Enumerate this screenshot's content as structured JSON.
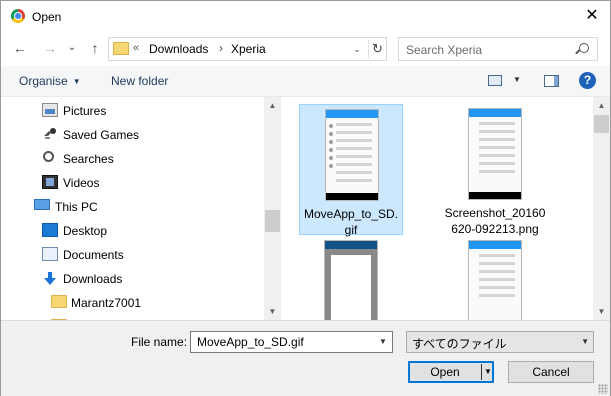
{
  "window": {
    "title": "Open",
    "close_label": "✕"
  },
  "navigation": {
    "back_icon": "←",
    "forward_icon": "→",
    "recent_icon": "⌄",
    "up_icon": "↑",
    "address": {
      "overflow": "«",
      "crumbs": [
        "Downloads",
        "Xperia"
      ],
      "separator": "›",
      "dropdown_icon": "⌄",
      "refresh_icon": "↻"
    },
    "search": {
      "placeholder": "Search Xperia"
    }
  },
  "toolbar": {
    "organise_label": "Organise",
    "new_folder_label": "New folder",
    "help_label": "?"
  },
  "nav_tree": [
    {
      "label": "Pictures",
      "icon": "pictures-icon"
    },
    {
      "label": "Saved Games",
      "icon": "saved-games-icon"
    },
    {
      "label": "Searches",
      "icon": "searches-icon"
    },
    {
      "label": "Videos",
      "icon": "videos-icon"
    },
    {
      "label": "This PC",
      "icon": "this-pc-icon"
    },
    {
      "label": "Desktop",
      "icon": "desktop-icon"
    },
    {
      "label": "Documents",
      "icon": "documents-icon"
    },
    {
      "label": "Downloads",
      "icon": "downloads-icon"
    },
    {
      "label": "Marantz7001",
      "icon": "folder-icon"
    }
  ],
  "files": [
    {
      "name": "MoveApp_to_SD.gif",
      "name_lines": [
        "MoveApp_to_SD.",
        "gif"
      ],
      "selected": true
    },
    {
      "name": "Screenshot_20160620-092213.png",
      "name_lines": [
        "Screenshot_20160",
        "620-092213.png"
      ],
      "selected": false
    },
    {
      "name": "",
      "name_lines": [
        "",
        ""
      ],
      "selected": false
    },
    {
      "name": "",
      "name_lines": [
        "",
        ""
      ],
      "selected": false
    }
  ],
  "bottom": {
    "file_name_label": "File name:",
    "file_name_value": "MoveApp_to_SD.gif",
    "file_type_value": "すべてのファイル",
    "open_label": "Open",
    "cancel_label": "Cancel"
  },
  "colors": {
    "accent": "#0078d7",
    "selection": "#cce8ff",
    "link": "#1e395b"
  }
}
